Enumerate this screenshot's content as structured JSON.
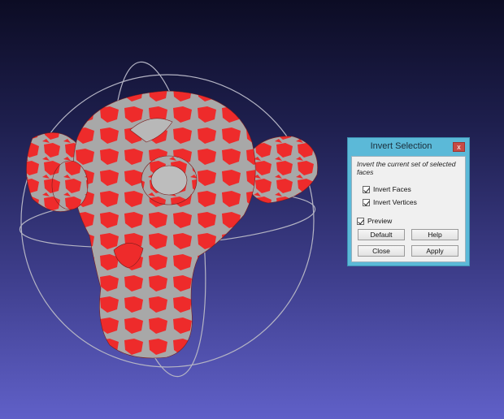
{
  "dialog": {
    "title": "Invert Selection",
    "close_glyph": "x",
    "description": "Invert the current set of selected faces",
    "options": {
      "invert_faces": {
        "label": "Invert Faces",
        "checked": true
      },
      "invert_vertices": {
        "label": "Invert Vertices",
        "checked": true
      },
      "preview": {
        "label": "Preview",
        "checked": true
      }
    },
    "buttons": {
      "default": "Default",
      "help": "Help",
      "close": "Close",
      "apply": "Apply"
    }
  },
  "colors": {
    "background_top": "#0c0c24",
    "background_bottom": "#6060c8",
    "mesh_selected": "#ee2b2b",
    "mesh_unselected": "#a8a8a8",
    "dialog_frame": "#5bb9d8",
    "close_button": "#c74a44"
  }
}
